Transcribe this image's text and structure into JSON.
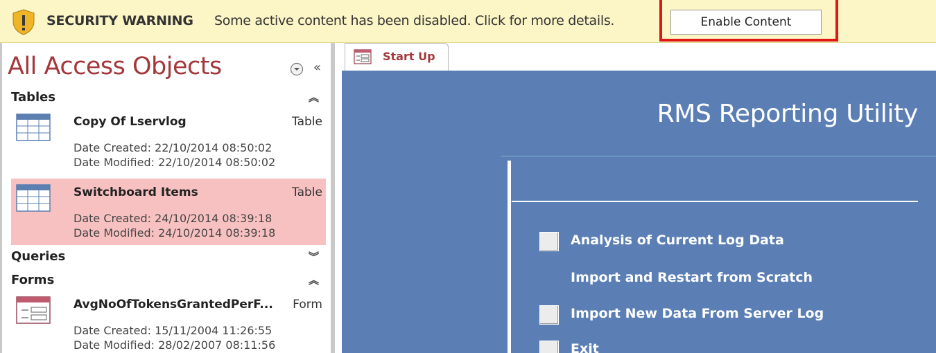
{
  "security_bar": {
    "title": "SECURITY WARNING",
    "message": "Some active content has been disabled. Click for more details.",
    "enable_button": "Enable Content",
    "colors": {
      "background": "#fcf5c6",
      "highlight_border": "#e01616"
    }
  },
  "nav_pane": {
    "title": "All Access Objects",
    "groups": [
      {
        "label": "Tables",
        "items": [
          {
            "name": "Copy Of Lservlog",
            "type": "Table",
            "created": "Date Created: 22/10/2014 08:50:02",
            "modified": "Date Modified: 22/10/2014 08:50:02",
            "selected": false,
            "icon": "table-icon"
          },
          {
            "name": "Switchboard Items",
            "type": "Table",
            "created": "Date Created: 24/10/2014 08:39:18",
            "modified": "Date Modified: 24/10/2014 08:39:18",
            "selected": true,
            "icon": "table-icon"
          }
        ]
      },
      {
        "label": "Queries",
        "items": []
      },
      {
        "label": "Forms",
        "items": [
          {
            "name": "AvgNoOfTokensGrantedPerF...",
            "type": "Form",
            "created": "Date Created: 15/11/2004 11:26:55",
            "modified": "Date Modified: 28/02/2007 08:11:56",
            "selected": false,
            "icon": "form-icon"
          }
        ]
      }
    ],
    "colors": {
      "title": "#a4373a",
      "selected_bg": "#f8c1c1"
    }
  },
  "document": {
    "tab_label": "Start Up",
    "form_title": "RMS Reporting Utility",
    "switchboard_items": [
      {
        "label": "Analysis of Current Log Data",
        "has_button": true
      },
      {
        "label": "Import and Restart from Scratch",
        "has_button": false
      },
      {
        "label": "Import New Data From Server Log",
        "has_button": true
      },
      {
        "label": "Exit",
        "has_button": true
      }
    ],
    "colors": {
      "form_bg": "#5b7fb5"
    }
  }
}
